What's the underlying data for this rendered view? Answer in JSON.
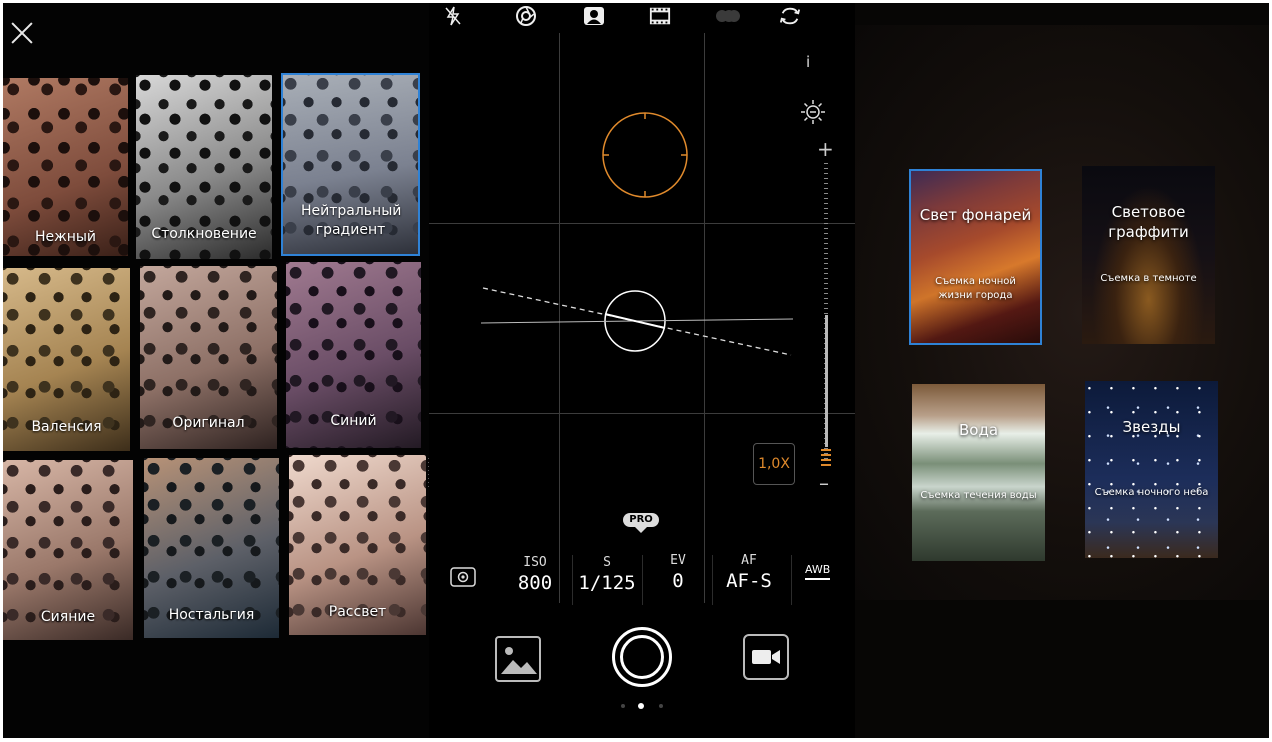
{
  "colors": {
    "accent_blue": "#2f82d6",
    "accent_orange": "#e08a2c",
    "background": "#000000"
  },
  "filters_panel": {
    "close_icon": "close-icon",
    "filters": [
      {
        "label": "Нежный",
        "selected": false
      },
      {
        "label": "Столкновение",
        "selected": false
      },
      {
        "label": "Нейтральный градиент",
        "selected": true
      },
      {
        "label": "Валенсия",
        "selected": false
      },
      {
        "label": "Оригинал",
        "selected": false
      },
      {
        "label": "Синий",
        "selected": false
      },
      {
        "label": "Сияние",
        "selected": false
      },
      {
        "label": "Ностальгия",
        "selected": false
      },
      {
        "label": "Рассвет",
        "selected": false
      }
    ]
  },
  "camera": {
    "top_icons": [
      "flash-off-icon",
      "aperture-icon",
      "portrait-icon",
      "film-icon",
      "toggle-icon",
      "switch-camera-icon"
    ],
    "info_label": "i",
    "zoom": "1,0X",
    "pro_label": "PRO",
    "params": {
      "iso": {
        "key": "ISO",
        "value": "800"
      },
      "shutter": {
        "key": "S",
        "value": "1/125"
      },
      "ev": {
        "key": "EV",
        "value": "0"
      },
      "af": {
        "key": "AF",
        "value": "AF-S"
      },
      "wb": "AWB"
    },
    "page_dots": 3,
    "active_dot": 2
  },
  "modes_panel": {
    "modes": [
      {
        "title": "Свет фонарей",
        "subtitle": "Съемка ночной жизни города",
        "selected": true
      },
      {
        "title": "Световое граффити",
        "subtitle": "Съемка в темноте",
        "selected": false
      },
      {
        "title": "Вода",
        "subtitle": "Съемка течения воды",
        "selected": false
      },
      {
        "title": "Звезды",
        "subtitle": "Съемка ночного неба",
        "selected": false
      }
    ]
  }
}
